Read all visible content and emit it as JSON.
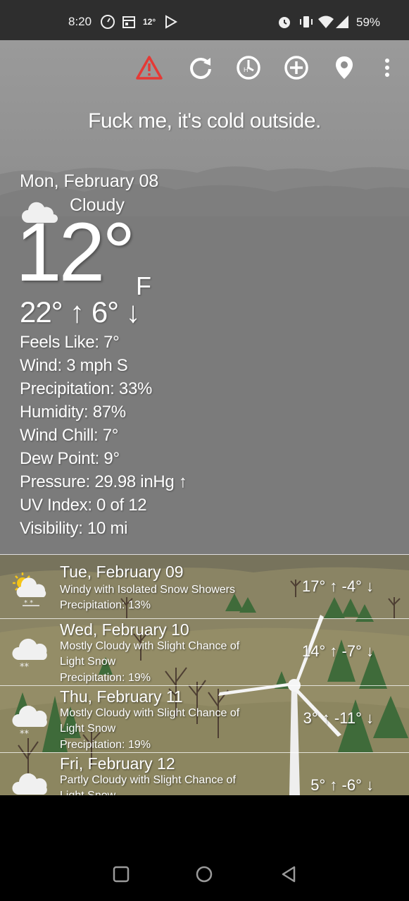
{
  "status_bar": {
    "time": "8:20",
    "temp_badge": "12°",
    "battery": "59%"
  },
  "toolbar": {
    "icons": [
      "alert-icon",
      "refresh-icon",
      "history-icon",
      "add-location-icon",
      "location-pin-icon",
      "more-vert-icon"
    ],
    "alert_color": "#e53935"
  },
  "tagline": "Fuck me, it's cold outside.",
  "current": {
    "date": "Mon, February 08",
    "condition": "Cloudy",
    "temperature": "12°",
    "unit": "F",
    "high_low": "22° ↑  6° ↓",
    "details": [
      "Feels Like: 7°",
      "Wind: 3 mph S",
      "Precipitation: 33%",
      "Humidity: 87%",
      "Wind Chill: 7°",
      "Dew Point: 9°",
      "Pressure: 29.98 inHg ↑",
      "UV Index: 0 of 12",
      "Visibility: 10 mi"
    ]
  },
  "forecast": [
    {
      "day": "Tue, February 09",
      "icon": "partly-sunny-snow-icon",
      "description": "Windy with Isolated Snow Showers",
      "precipitation": "Precipitation: 13%",
      "high_low": "17° ↑  -4° ↓"
    },
    {
      "day": "Wed, February 10",
      "icon": "cloud-snow-icon",
      "description": "Mostly Cloudy with Slight Chance of Light Snow",
      "precipitation": "Precipitation: 19%",
      "high_low": "14° ↑  -7° ↓"
    },
    {
      "day": "Thu, February 11",
      "icon": "cloud-snow-icon",
      "description": "Mostly Cloudy with Slight Chance of Light Snow",
      "precipitation": "Precipitation: 19%",
      "high_low": "3° ↑  -11° ↓"
    },
    {
      "day": "Fri, February 12",
      "icon": "cloud-icon",
      "description": "Partly Cloudy with Slight Chance of Light Snow",
      "precipitation": "",
      "high_low": "5° ↑  -6° ↓"
    }
  ]
}
